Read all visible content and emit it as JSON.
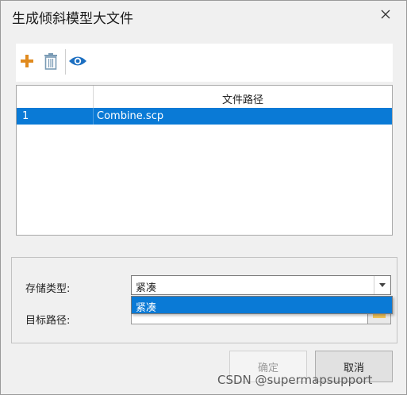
{
  "window": {
    "title": "生成倾斜模型大文件"
  },
  "toolbar": {
    "add_icon": "plus-icon",
    "delete_icon": "trash-icon",
    "preview_icon": "eye-icon",
    "accent_add": "#e08a1e",
    "accent_eye": "#1c6fc1"
  },
  "table": {
    "columns": [
      "",
      "文件路径"
    ],
    "rows": [
      {
        "index": "1",
        "path": "Combine.scp",
        "selected": true
      }
    ]
  },
  "form": {
    "storage_type_label": "存储类型:",
    "storage_type_value": "紧凑",
    "dropdown_options": [
      "紧凑"
    ],
    "target_path_label": "目标路径:",
    "target_path_value": ""
  },
  "buttons": {
    "ok_label": "确定",
    "cancel_label": "取消"
  },
  "watermark": "CSDN @supermapsupport",
  "colors": {
    "selection": "#0a7ad6"
  }
}
